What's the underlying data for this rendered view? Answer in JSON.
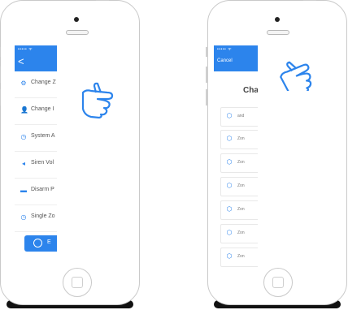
{
  "left_phone": {
    "status_bar": "••••• ᯤ",
    "back_label": "<",
    "menu_items": [
      {
        "icon": "gear-icon",
        "label": "Change Z"
      },
      {
        "icon": "person-icon",
        "label": "Change I"
      },
      {
        "icon": "clock-icon",
        "label": "System A"
      },
      {
        "icon": "speaker-icon",
        "label": "Siren Vol"
      },
      {
        "icon": "unlock-icon",
        "label": "Disarm P"
      },
      {
        "icon": "clock-icon",
        "label": "Single Zo"
      }
    ],
    "action_button_label": "E"
  },
  "right_phone": {
    "status_bar": "••••• ᯤ",
    "cancel_label": "Cancel",
    "title": "Cha",
    "zones": [
      {
        "label": "and"
      },
      {
        "label": "Zon"
      },
      {
        "label": "Zon"
      },
      {
        "label": "Zon"
      },
      {
        "label": "Zon"
      },
      {
        "label": "Zon"
      },
      {
        "label": "Zon"
      }
    ]
  },
  "colors": {
    "accent": "#2c84ec",
    "frame": "#c9c9c9"
  }
}
